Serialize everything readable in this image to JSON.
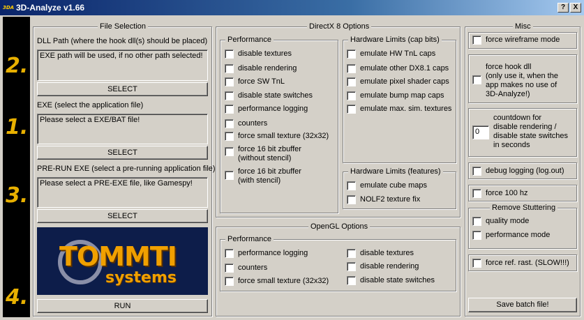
{
  "window": {
    "title": "3D-Analyze v1.66",
    "icon_text": "3DA",
    "help_button": "?",
    "close_button": "X"
  },
  "steps": [
    "2.",
    "1.",
    "3.",
    "4."
  ],
  "file_selection": {
    "title": "File Selection",
    "dll_label": "DLL Path (where the hook dll(s) should be placed)",
    "dll_value": "EXE path will be used, if no other path selected!",
    "exe_label": "EXE (select the application file)",
    "exe_value": "Please select a EXE/BAT file!",
    "prerun_label": "PRE-RUN EXE (select a pre-running application file)",
    "prerun_value": "Please select a PRE-EXE file, like Gamespy!",
    "select_label": "SELECT",
    "run_label": "RUN"
  },
  "logo": {
    "main": "TOMMTI",
    "sub": "systems"
  },
  "directx": {
    "title": "DirectX 8 Options",
    "performance": {
      "title": "Performance",
      "items": [
        "disable textures",
        "disable rendering",
        "force SW TnL",
        "disable state switches",
        "performance logging",
        "counters",
        "force small texture (32x32)",
        "force 16 bit zbuffer",
        "(without stencil)",
        "force 16 bit zbuffer",
        "(with stencil)"
      ]
    },
    "caps": {
      "title": "Hardware Limits (cap bits)",
      "items": [
        "emulate HW TnL caps",
        "emulate other DX8.1 caps",
        "emulate pixel shader caps",
        "emulate bump map caps",
        "emulate max. sim. textures"
      ]
    },
    "features": {
      "title": "Hardware Limits (features)",
      "items": [
        "emulate cube maps",
        "NOLF2 texture fix"
      ]
    }
  },
  "opengl": {
    "title": "OpenGL Options",
    "performance_title": "Performance",
    "left": [
      "performance logging",
      "counters",
      "force small texture (32x32)"
    ],
    "right": [
      "disable textures",
      "disable rendering",
      "disable state switches"
    ]
  },
  "misc": {
    "title": "Misc",
    "wireframe": "force wireframe mode",
    "hook_lines": [
      "force hook dll",
      "(only use it, when the",
      "app makes no use of",
      "3D-Analyze!)"
    ],
    "countdown_value": "0",
    "countdown_lines": [
      "countdown for",
      "disable rendering /",
      "disable state switches",
      "in seconds"
    ],
    "debug": "debug logging (log.out)",
    "force100": "force 100 hz",
    "stutter_title": "Remove Stuttering",
    "quality": "quality mode",
    "performance": "performance mode",
    "refrast": "force ref. rast. (SLOW!!!)",
    "save_label": "Save batch file!"
  }
}
